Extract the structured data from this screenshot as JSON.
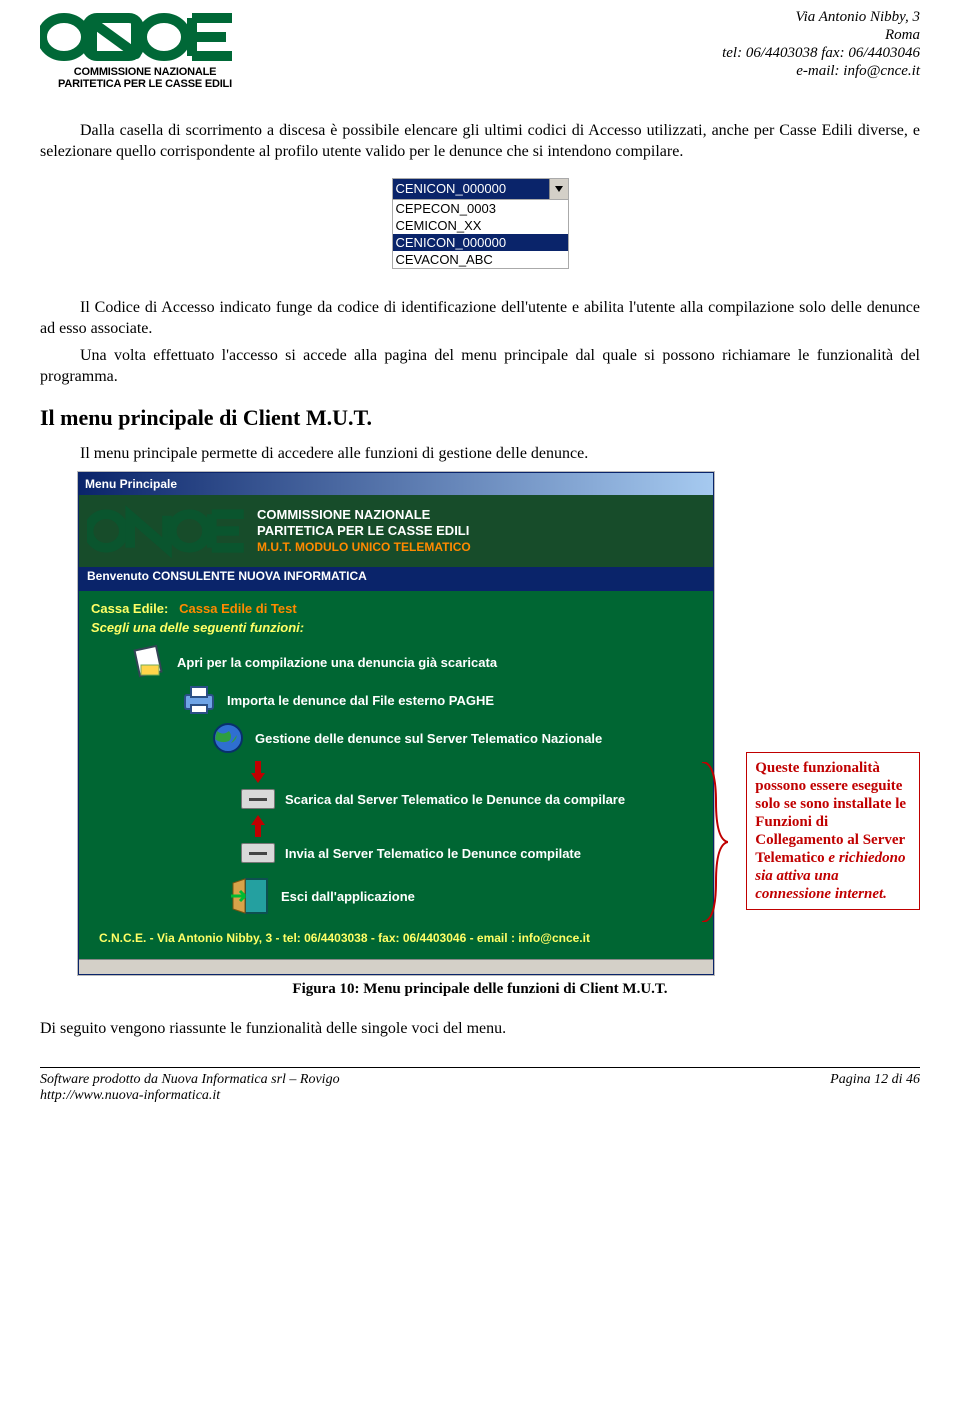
{
  "header": {
    "logo_line1": "COMMISSIONE NAZIONALE",
    "logo_line2": "PARITETICA PER LE CASSE EDILI",
    "addr1": "Via Antonio Nibby, 3",
    "addr2": "Roma",
    "addr3": "tel: 06/4403038    fax: 06/4403046",
    "addr4": "e-mail: info@cnce.it"
  },
  "body": {
    "p1": "Dalla casella di scorrimento a discesa è possibile elencare gli ultimi codici di Accesso utilizzati, anche per Casse Edili diverse, e selezionare quello corrispondente al profilo utente valido per le denunce che si intendono compilare.",
    "p2": "Il Codice di Accesso indicato funge da codice di identificazione dell'utente e abilita l'utente alla compilazione solo delle denunce ad esso associate.",
    "p3": "Una volta effettuato l'accesso si accede alla pagina del menu principale dal quale si possono richiamare le funzionalità del programma.",
    "h_menu": "Il menu principale di Client M.U.T.",
    "p4": "Il menu principale permette di accedere alle funzioni di gestione delle denunce.",
    "p5": "Di seguito vengono riassunte le funzionalità delle singole voci del menu.",
    "fig_caption": "Figura 10: Menu principale delle funzioni di Client M.U.T."
  },
  "dropdown": {
    "selected": "CENICON_000000",
    "items": [
      "CEPECON_0003",
      "CEMICON_XX",
      "CENICON_000000",
      "CEVACON_ABC"
    ]
  },
  "shot": {
    "title": "Menu Principale",
    "banner_line1": "COMMISSIONE NAZIONALE",
    "banner_line2": "PARITETICA PER LE CASSE EDILI",
    "banner_sub": "M.U.T. MODULO UNICO TELEMATICO",
    "welcome": "Benvenuto CONSULENTE NUOVA INFORMATICA",
    "ce_label": "Cassa Edile:",
    "ce_value": "Cassa Edile di Test",
    "choose": "Scegli una delle seguenti funzioni:",
    "m1": "Apri per la compilazione una denuncia già scaricata",
    "m2": "Importa le denunce dal File esterno PAGHE",
    "m3": "Gestione delle denunce  sul Server Telematico Nazionale",
    "m4": "Scarica dal Server Telematico  le Denunce da compilare",
    "m5": "Invia al Server Telematico le Denunce compilate",
    "m6": "Esci dall'applicazione",
    "footer": "C.N.C.E. - Via Antonio Nibby, 3 - tel: 06/4403038 - fax: 06/4403046 - email : info@cnce.it"
  },
  "callout": {
    "l1": "Queste funzionalità possono essere eseguite solo se   sono installate le Funzioni di Collegamento al Server Telematico ",
    "l2": "e richiedono sia attiva una connessione internet."
  },
  "footer": {
    "left1": "Software prodotto da Nuova Informatica srl – Rovigo",
    "left2": "http://www.nuova-informatica.it",
    "right": "Pagina 12 di 46"
  }
}
